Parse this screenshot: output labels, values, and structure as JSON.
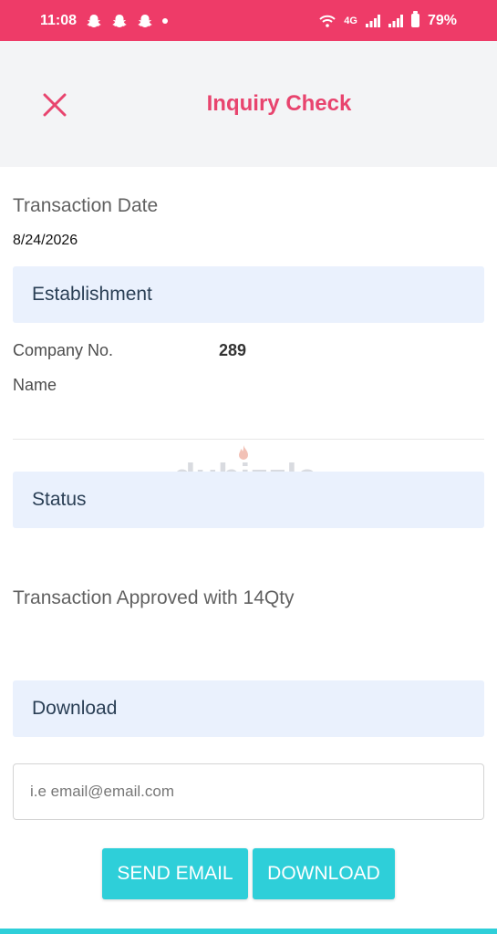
{
  "status_bar": {
    "time": "11:08",
    "network": "4G",
    "battery": "79%",
    "icons": [
      "snapchat-icon",
      "snapchat-icon",
      "snapchat-icon",
      "notification-dot-icon",
      "wifi-icon",
      "signal-icon",
      "signal-icon",
      "battery-icon"
    ],
    "background": "#ee3b68"
  },
  "header": {
    "title": "Inquiry Check",
    "close_icon": "close-icon",
    "title_color": "#e8446e"
  },
  "transaction": {
    "date_label": "Transaction Date",
    "date_value": "8/24/2026"
  },
  "establishment": {
    "section_title": "Establishment",
    "company_no_label": "Company No.",
    "company_no_value": "289",
    "name_label": "Name"
  },
  "watermark": "dubizzle",
  "status": {
    "section_title": "Status",
    "message": "Transaction Approved with 14Qty"
  },
  "download": {
    "section_title": "Download",
    "email_placeholder": "i.e email@email.com",
    "send_email_label": "SEND EMAIL",
    "download_label": "DOWNLOAD",
    "button_color": "#2ecfd9"
  }
}
